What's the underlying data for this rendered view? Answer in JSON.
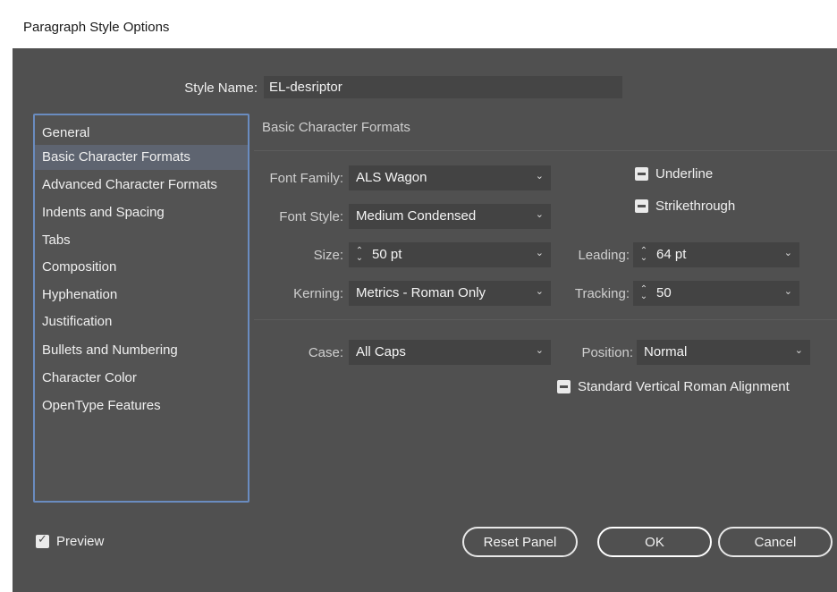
{
  "window": {
    "title": "Paragraph Style Options"
  },
  "style_name": {
    "label": "Style Name:",
    "value": "EL-desriptor"
  },
  "nav": {
    "items": [
      {
        "label": "General"
      },
      {
        "label": "Basic Character Formats",
        "selected": true
      },
      {
        "label": "Advanced Character Formats"
      },
      {
        "label": "Indents and Spacing"
      },
      {
        "label": "Tabs"
      },
      {
        "label": "Composition"
      },
      {
        "label": "Hyphenation"
      },
      {
        "label": "Justification"
      },
      {
        "label": "Bullets and Numbering"
      },
      {
        "label": "Character Color"
      },
      {
        "label": "OpenType Features"
      }
    ]
  },
  "section": {
    "title": "Basic Character Formats"
  },
  "fields": {
    "font_family": {
      "label": "Font Family:",
      "value": "ALS Wagon"
    },
    "font_style": {
      "label": "Font Style:",
      "value": "Medium Condensed"
    },
    "size": {
      "label": "Size:",
      "value": "50 pt"
    },
    "leading": {
      "label": "Leading:",
      "value": "64 pt"
    },
    "kerning": {
      "label": "Kerning:",
      "value": "Metrics - Roman Only"
    },
    "tracking": {
      "label": "Tracking:",
      "value": "50"
    },
    "case": {
      "label": "Case:",
      "value": "All Caps"
    },
    "position": {
      "label": "Position:",
      "value": "Normal"
    }
  },
  "checkboxes": {
    "underline": {
      "label": "Underline",
      "state": "mixed"
    },
    "strikethrough": {
      "label": "Strikethrough",
      "state": "mixed"
    },
    "standard_vertical": {
      "label": "Standard Vertical Roman Alignment",
      "state": "mixed"
    },
    "preview": {
      "label": "Preview",
      "state": "checked"
    }
  },
  "buttons": {
    "reset": "Reset Panel",
    "ok": "OK",
    "cancel": "Cancel"
  },
  "colors": {
    "dialog_bg": "#505050",
    "field_bg": "#434343",
    "selection_bg": "#5e6470",
    "list_border": "#6a8cc0"
  }
}
